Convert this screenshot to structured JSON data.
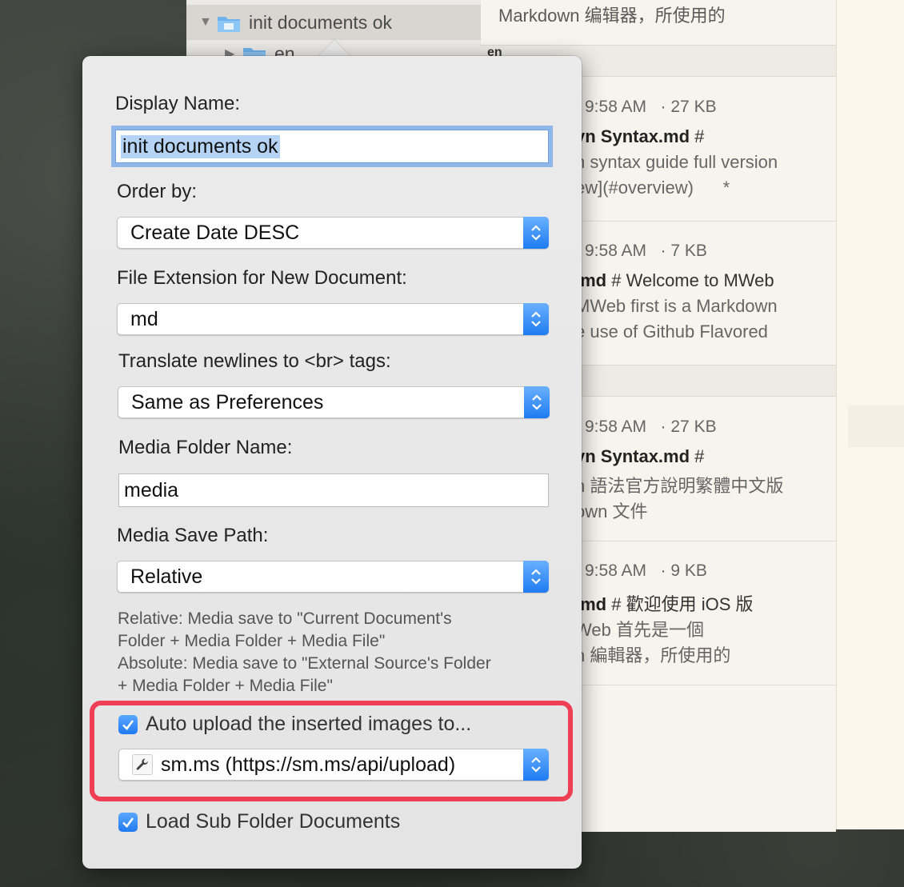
{
  "sidebar": {
    "selected_folder": "init documents ok",
    "child_folder": "en"
  },
  "doc_list": {
    "top_text": "Markdown 编辑器，所使用的",
    "section_label": "en",
    "items": [
      {
        "meta": "9:58 AM   · 27 KB",
        "title_bold": "vn Syntax.md",
        "title_rest": " #",
        "line1": "n syntax guide full version",
        "line2": "ew](#overview)      *"
      },
      {
        "meta": "9:58 AM   · 7 KB",
        "title_bold": ".md",
        "title_rest": " # Welcome to MWeb",
        "line1": "MWeb first is a Markdown",
        "line2": "e use of Github Flavored"
      },
      {
        "meta": "9:58 AM   · 27 KB",
        "title_bold": "vn Syntax.md",
        "title_rest": " #",
        "line1": "n 語法官方說明繁體中文版",
        "line2": "own 文件"
      },
      {
        "meta": "9:58 AM   · 9 KB",
        "title_bold": ".md",
        "title_rest": " # 歡迎使用 iOS 版",
        "line1": "Web 首先是一個",
        "line2": "n 編輯器，所使用的"
      }
    ]
  },
  "popover": {
    "display_name_label": "Display Name:",
    "display_name_value": "init documents ok",
    "order_by_label": "Order by:",
    "order_by_value": "Create Date DESC",
    "file_ext_label": "File Extension for New Document:",
    "file_ext_value": "md",
    "newlines_label": "Translate newlines to <br> tags:",
    "newlines_value": "Same as Preferences",
    "media_folder_label": "Media Folder Name:",
    "media_folder_value": "media",
    "media_path_label": "Media Save Path:",
    "media_path_value": "Relative",
    "note_lines": [
      "Relative: Media save to \"Current Document's",
      "Folder + Media Folder + Media File\"",
      "Absolute: Media save to \"External Source's Folder",
      "+ Media Folder + Media File\""
    ],
    "auto_upload_label": "Auto upload the inserted images to...",
    "auto_upload_checked": true,
    "upload_service_value": "sm.ms (https://sm.ms/api/upload)",
    "load_sub_label": "Load Sub Folder Documents",
    "load_sub_checked": true
  },
  "colors": {
    "accent": "#1f7af0",
    "highlight_border": "#ef3f55",
    "focus_ring": "#8fb7ea"
  }
}
